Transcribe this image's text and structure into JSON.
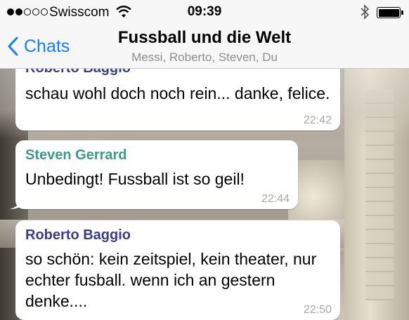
{
  "status_bar": {
    "carrier": "Swisscom",
    "time": "09:39",
    "signal_bars_filled": 2,
    "signal_bars_total": 5,
    "battery_level": 1.0
  },
  "nav": {
    "back_label": "Chats",
    "title": "Fussball und die Welt",
    "subtitle": "Messi, Roberto, Steven, Du"
  },
  "messages": [
    {
      "sender": "Roberto Baggio",
      "text": "schau wohl doch noch rein... danke, felice.",
      "time": "22:42",
      "sender_color": "#3a3c8c"
    },
    {
      "sender": "Steven Gerrard",
      "text": "Unbedingt! Fussball ist so geil!",
      "time": "22:44",
      "sender_color": "#3c9a8a"
    },
    {
      "sender": "Roberto Baggio",
      "text": "so schön: kein zeitspiel, kein theater, nur echter fusball. wenn ich an gestern denke....",
      "time": "22:50",
      "sender_color": "#3a3c8c"
    }
  ],
  "colors": {
    "accent": "#147efb",
    "bubble": "#ffffff"
  }
}
